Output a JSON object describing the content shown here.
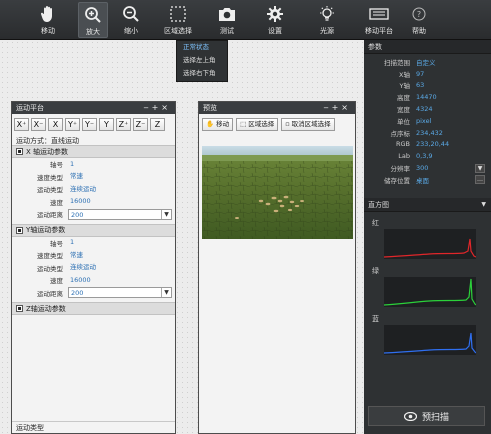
{
  "toolbar": {
    "items": [
      {
        "label": "移动",
        "icon": "hand-icon"
      },
      {
        "label": "放大",
        "icon": "zoom-in-icon"
      },
      {
        "label": "缩小",
        "icon": "zoom-out-icon"
      },
      {
        "label": "区域选择",
        "icon": "area-select-icon"
      },
      {
        "label": "测试",
        "icon": "camera-icon"
      },
      {
        "label": "设置",
        "icon": "gear-icon"
      },
      {
        "label": "光源",
        "icon": "light-bulb-icon"
      },
      {
        "label": "移动平台",
        "icon": "platform-icon"
      },
      {
        "label": "帮助",
        "icon": "help-icon"
      }
    ],
    "active": "放大"
  },
  "area_menu": {
    "items": [
      "正常状态",
      "选择左上角",
      "选择右下角"
    ],
    "selected": "正常状态"
  },
  "motion_panel": {
    "title": "运动平台",
    "axis_buttons": [
      "X⁺",
      "X⁻",
      "X",
      "Y⁺",
      "Y⁻",
      "Y",
      "Z⁺",
      "Z⁻",
      "Z"
    ],
    "mode_text": "运动方式：直线运动",
    "x_section": {
      "title": "X 轴运动参数",
      "rows": [
        {
          "k": "轴号",
          "v": "1"
        },
        {
          "k": "速度类型",
          "v": "常速"
        },
        {
          "k": "运动类型",
          "v": "连续运动"
        },
        {
          "k": "速度",
          "v": "16000"
        },
        {
          "k": "运动距离",
          "v": "200"
        }
      ]
    },
    "y_section": {
      "title": "Y轴运动参数",
      "rows": [
        {
          "k": "轴号",
          "v": "1"
        },
        {
          "k": "速度类型",
          "v": "常速"
        },
        {
          "k": "运动类型",
          "v": "连续运动"
        },
        {
          "k": "速度",
          "v": "16000"
        },
        {
          "k": "运动距离",
          "v": "200"
        }
      ]
    },
    "z_section": {
      "title": "Z轴运动参数"
    },
    "footer": "运动类型"
  },
  "preview_panel": {
    "title": "预览",
    "buttons": [
      "移动",
      "区域选择",
      "取消区域选择"
    ]
  },
  "params": {
    "title": "参数",
    "rows": [
      {
        "k": "扫描范围",
        "v": "自定义"
      },
      {
        "k": "X轴",
        "v": "97"
      },
      {
        "k": "Y轴",
        "v": "63"
      },
      {
        "k": "高度",
        "v": "14470"
      },
      {
        "k": "宽度",
        "v": "4324"
      },
      {
        "k": "单位",
        "v": "pixel"
      },
      {
        "k": "点序标",
        "v": "234,432"
      },
      {
        "k": "RGB",
        "v": "233,20,44"
      },
      {
        "k": "Lab",
        "v": "0,3,9"
      },
      {
        "k": "分辨率",
        "v": "300"
      },
      {
        "k": "储存位置",
        "v": "桌面"
      }
    ]
  },
  "histogram": {
    "title": "直方图",
    "channels": [
      {
        "label": "红",
        "color": "#e0262a"
      },
      {
        "label": "绿",
        "color": "#2bd13a"
      },
      {
        "label": "蓝",
        "color": "#2f6ff0"
      }
    ]
  },
  "scan_button": {
    "label": "预扫描",
    "icon": "eye-icon"
  },
  "colors": {
    "accent": "#5aa9e6",
    "toolbar": "#2e3133"
  }
}
